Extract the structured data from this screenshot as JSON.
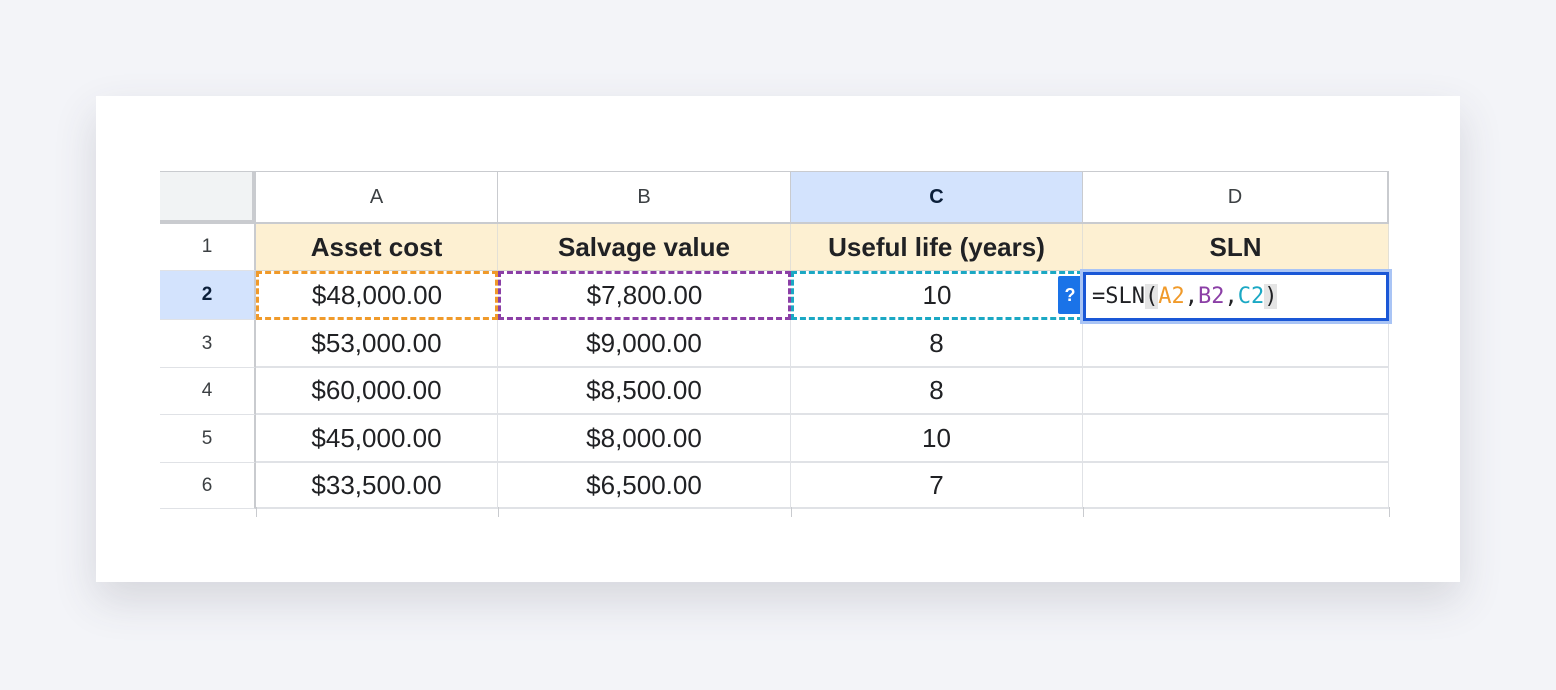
{
  "columns": [
    "A",
    "B",
    "C",
    "D"
  ],
  "selected_column": "C",
  "rows": [
    "1",
    "2",
    "3",
    "4",
    "5",
    "6"
  ],
  "selected_row": "2",
  "headers": [
    "Asset cost",
    "Salvage value",
    "Useful life (years)",
    "SLN"
  ],
  "data": [
    [
      "$48,000.00",
      "$7,800.00",
      "10"
    ],
    [
      "$53,000.00",
      "$9,000.00",
      "8"
    ],
    [
      "$60,000.00",
      "$8,500.00",
      "8"
    ],
    [
      "$45,000.00",
      "$8,000.00",
      "10"
    ],
    [
      "$33,500.00",
      "$6,500.00",
      "7"
    ]
  ],
  "formula": {
    "prefix": "=SLN",
    "open_paren": "(",
    "ref1": "A2",
    "comma1": ",",
    "ref2": "B2",
    "comma2": ",",
    "ref3": "C2",
    "close_paren": ")"
  },
  "help_button_label": "?",
  "colors": {
    "ref_a": "#f09a2a",
    "ref_b": "#8b3fa6",
    "ref_c": "#1ba8c4",
    "header_fill": "#fdf0d2",
    "selection": "#d3e3fd",
    "active_border": "#1a57d6"
  }
}
